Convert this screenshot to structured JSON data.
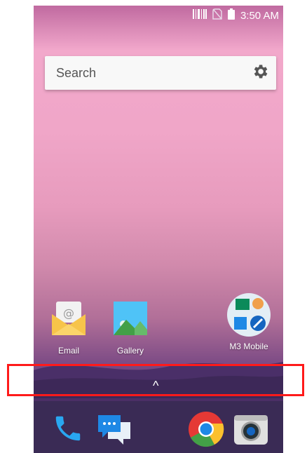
{
  "status_bar": {
    "time": "3:50 AM",
    "icons": [
      "barcode-icon",
      "no-sim-icon",
      "battery-icon"
    ]
  },
  "search": {
    "label": "Search",
    "settings_icon": "gear-icon"
  },
  "apps": [
    {
      "label": "Email",
      "icon": "email-icon"
    },
    {
      "label": "Gallery",
      "icon": "gallery-icon"
    },
    {
      "label": "M3 Mobile",
      "icon": "m3-mobile-folder-icon"
    }
  ],
  "drawer_handle": "^",
  "dock": [
    {
      "name": "phone",
      "icon": "phone-icon"
    },
    {
      "name": "messaging",
      "icon": "messaging-icon"
    },
    {
      "name": "chrome",
      "icon": "chrome-icon"
    },
    {
      "name": "camera",
      "icon": "camera-icon"
    }
  ],
  "colors": {
    "highlight_frame": "#ff1a1a",
    "dock_background": "#3a2b55"
  }
}
